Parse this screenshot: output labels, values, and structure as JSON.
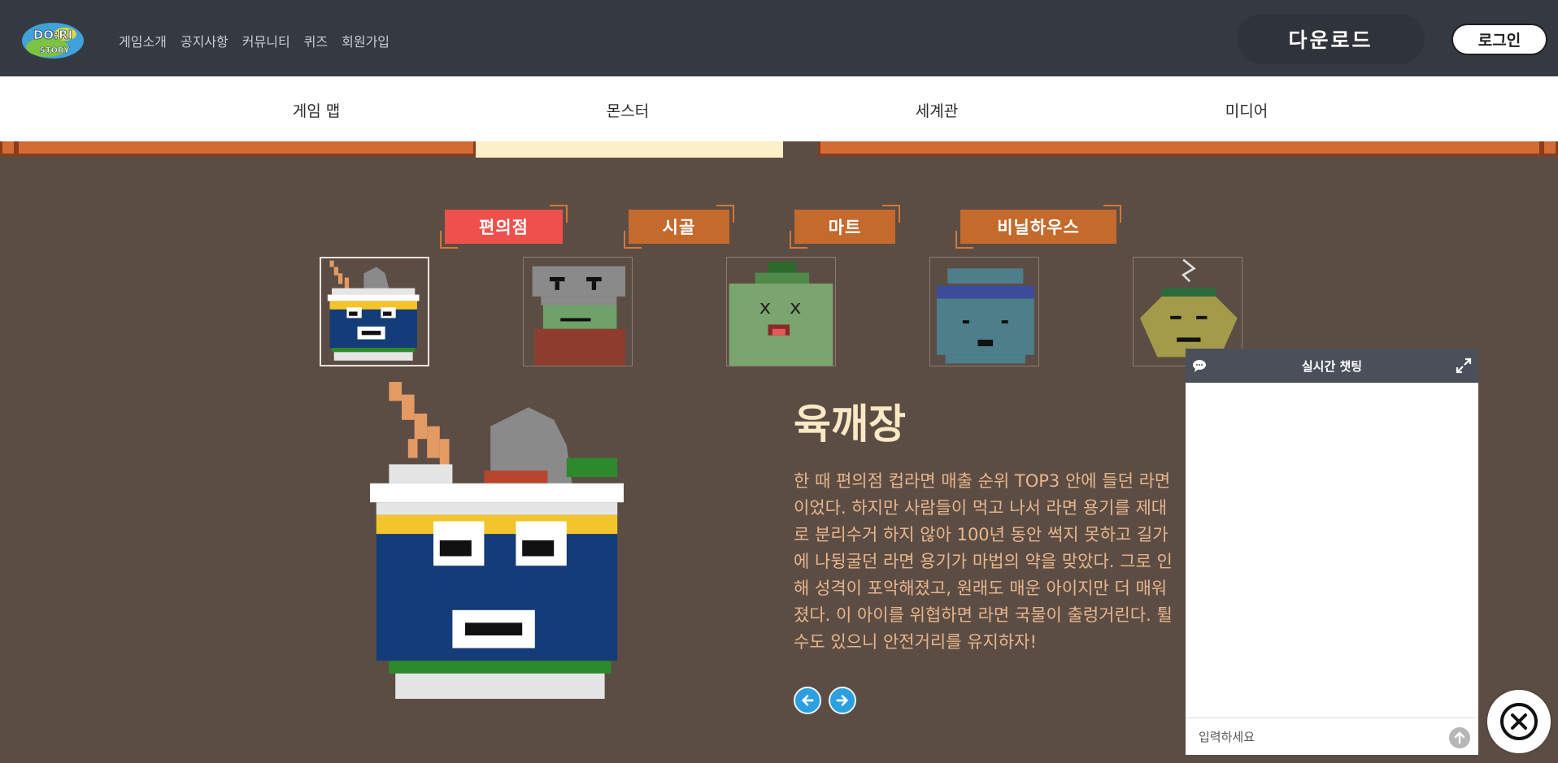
{
  "header": {
    "logo_text_top": "DO:RI",
    "logo_text_bottom": "STORY",
    "nav": [
      "게임소개",
      "공지사항",
      "커뮤니티",
      "퀴즈",
      "회원가입"
    ],
    "download_label": "다운로드",
    "login_label": "로그인"
  },
  "subnav": [
    "게임 맵",
    "몬스터",
    "세계관",
    "미디어"
  ],
  "categories": [
    {
      "label": "편의점",
      "active": true
    },
    {
      "label": "시골",
      "active": false
    },
    {
      "label": "마트",
      "active": false
    },
    {
      "label": "비닐하우스",
      "active": false
    }
  ],
  "thumbnails": [
    {
      "name": "ramen-cup-monster",
      "selected": true
    },
    {
      "name": "rice-cake-monster",
      "selected": false
    },
    {
      "name": "soju-bottle-monster",
      "selected": false
    },
    {
      "name": "jar-monster",
      "selected": false
    },
    {
      "name": "dumpling-monster",
      "selected": false
    }
  ],
  "detail": {
    "title": "육깨장",
    "description": "한 때 편의점 컵라면 매출 순위 TOP3 안에 들던 라면이었다. 하지만 사람들이 먹고 나서 라면 용기를 제대로 분리수거 하지 않아 100년 동안 썩지 못하고 길가에 나뒹굴던 라면 용기가 마법의 약을 맞았다. 그로 인해 성격이 포악해졌고, 원래도 매운 아이지만 더 매워졌다. 이 아이를 위협하면 라면 국물이 출렁거린다. 튈 수도 있으니 안전거리를 유지하자!"
  },
  "chat": {
    "title": "실시간 챗팅",
    "placeholder": "입력하세요",
    "icons": [
      "chat-bubble-icon",
      "expand-icon",
      "send-icon"
    ]
  },
  "colors": {
    "background": "#5c4d44",
    "topbar": "#353a42",
    "active_tab": "#f0504c",
    "inactive_tab": "#c56a2d",
    "title": "#fbe9c5",
    "description": "#e7b58c",
    "arrow": "#2b9fe0"
  }
}
